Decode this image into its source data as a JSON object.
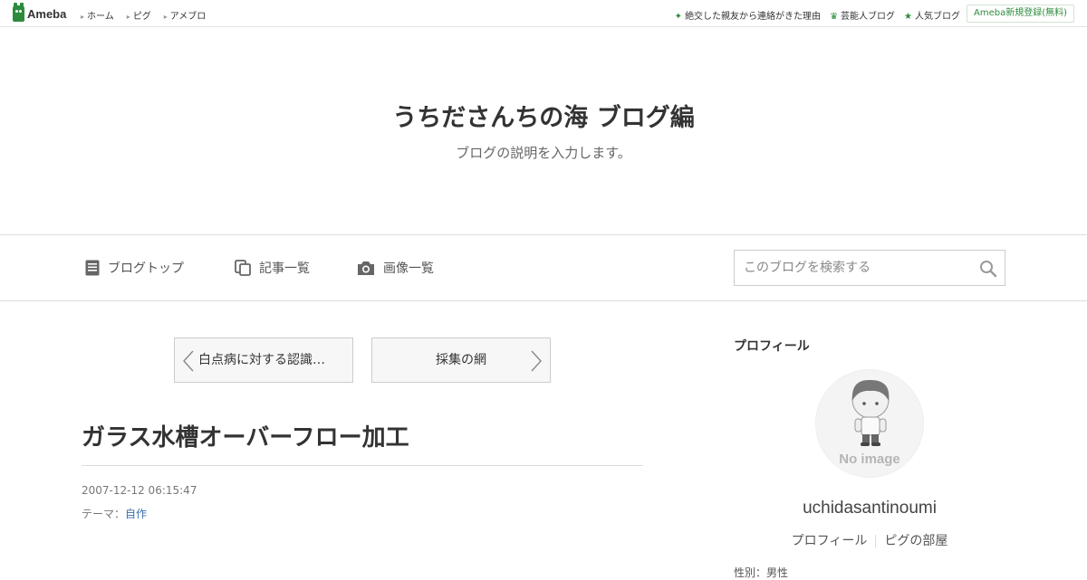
{
  "topbar": {
    "logo": "Ameba",
    "nav": [
      "ホーム",
      "ピグ",
      "アメブロ"
    ],
    "links": [
      {
        "icon": "sparkle-icon",
        "label": "絶交した親友から連絡がきた理由"
      },
      {
        "icon": "crown-icon",
        "label": "芸能人ブログ"
      },
      {
        "icon": "star-icon",
        "label": "人気ブログ"
      }
    ],
    "register": "Ameba新規登録(無料)"
  },
  "header": {
    "title": "うちださんちの海 ブログ編",
    "description": "ブログの説明を入力します。"
  },
  "nav": {
    "items": [
      {
        "icon": "document-icon",
        "label": "ブログトップ"
      },
      {
        "icon": "copy-icon",
        "label": "記事一覧"
      },
      {
        "icon": "camera-icon",
        "label": "画像一覧"
      }
    ],
    "search_placeholder": "このブログを検索する"
  },
  "pager": {
    "prev": "白点病に対する認識…",
    "next": "採集の網"
  },
  "entry": {
    "title": "ガラス水槽オーバーフロー加工",
    "date": "2007-12-12 06:15:47",
    "theme_label": "テーマ：",
    "theme": "自作"
  },
  "sidebar": {
    "heading": "プロフィール",
    "no_image": "No image",
    "username": "uchidasantinoumi",
    "links": [
      "プロフィール",
      "ピグの部屋"
    ],
    "cutoff": "性別：男性"
  }
}
